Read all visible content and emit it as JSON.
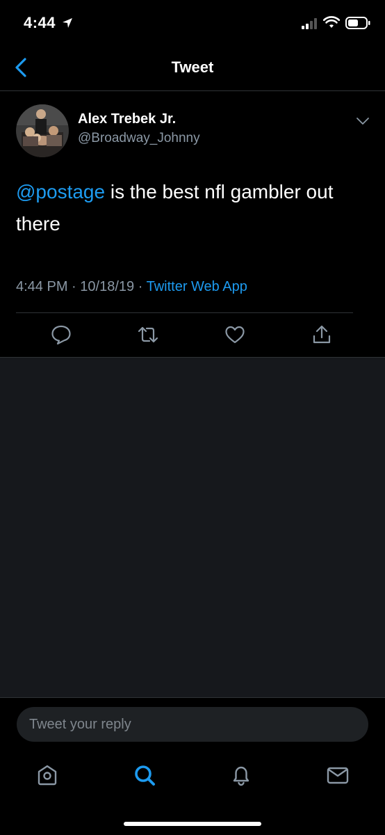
{
  "status_bar": {
    "time": "4:44"
  },
  "nav": {
    "title": "Tweet"
  },
  "tweet": {
    "author": {
      "display_name": "Alex Trebek Jr.",
      "handle": "@Broadway_Johnny"
    },
    "text": {
      "mention": "@postage",
      "body": " is the best nfl gambler out there"
    },
    "meta": {
      "time": "4:44 PM",
      "separator": "·",
      "date": "10/18/19",
      "source": "Twitter Web App"
    },
    "actions": [
      "reply-icon",
      "retweet-icon",
      "like-icon",
      "share-icon"
    ]
  },
  "reply": {
    "placeholder": "Tweet your reply"
  },
  "tab_bar": {
    "items": [
      "home-icon",
      "search-icon",
      "notifications-icon",
      "messages-icon"
    ],
    "active": "search-icon"
  },
  "colors": {
    "accent": "#1d9bf0",
    "secondary_text": "#8b98a5",
    "background": "#000000",
    "empty_area": "#16181c"
  }
}
